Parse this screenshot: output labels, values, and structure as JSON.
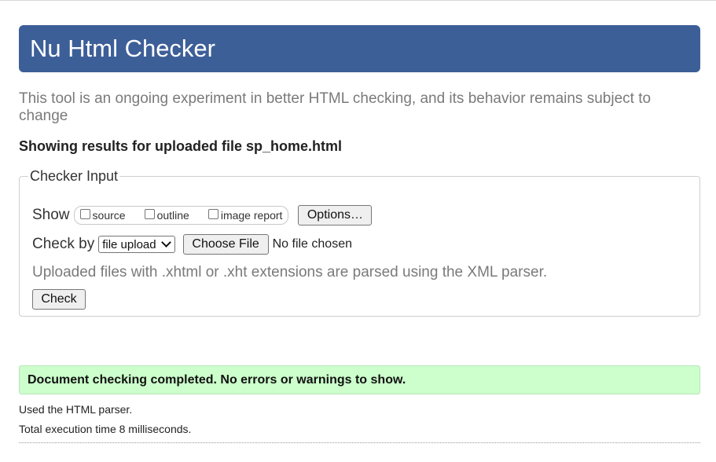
{
  "header": {
    "title": "Nu Html Checker"
  },
  "intro": "This tool is an ongoing experiment in better HTML checking, and its behavior remains subject to change",
  "results_for": "Showing results for uploaded file sp_home.html",
  "checker_input": {
    "legend": "Checker Input",
    "show_label": "Show",
    "show_options": [
      {
        "label": "source",
        "checked": false
      },
      {
        "label": "outline",
        "checked": false
      },
      {
        "label": "image report",
        "checked": false
      }
    ],
    "options_button": "Options…",
    "check_by_label": "Check by",
    "check_by_selected": "file upload",
    "choose_file_button": "Choose File",
    "no_file_text": "No file chosen",
    "xml_note": "Uploaded files with .xhtml or .xht extensions are parsed using the XML parser.",
    "check_button": "Check"
  },
  "result": {
    "success_message": "Document checking completed. No errors or warnings to show.",
    "parser_note": "Used the HTML parser.",
    "execution_time": "Total execution time 8 milliseconds."
  },
  "colors": {
    "banner": "#3d5f98",
    "success_bg": "#ccffcc",
    "muted_text": "#7a7a7a"
  }
}
